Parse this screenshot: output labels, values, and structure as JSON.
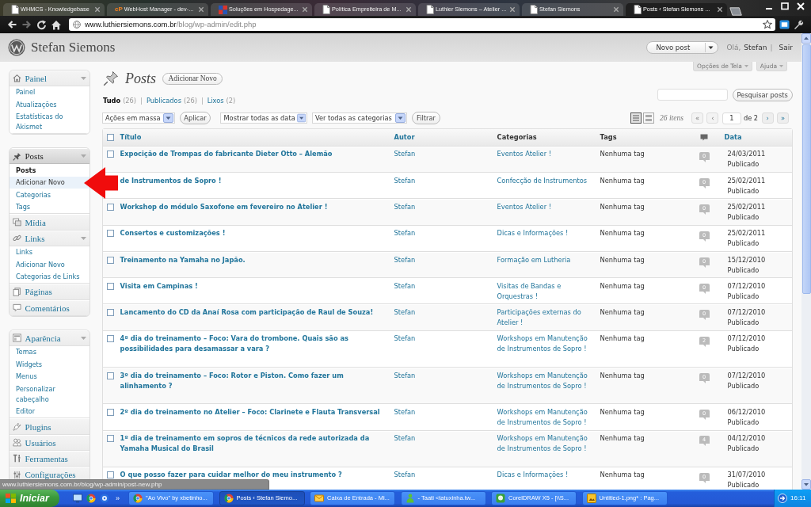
{
  "browser": {
    "tabs": [
      {
        "kind": "page",
        "title": "WHMCS - Knowledgebase",
        "selected": false
      },
      {
        "kind": "letters",
        "favicon": "cP",
        "title": "WebHost Manager - dev-...",
        "selected": false
      },
      {
        "kind": "tiles",
        "title": "Soluções em Hospedage...",
        "selected": false
      },
      {
        "kind": "page",
        "title": "Política Empreiteira de M...",
        "selected": false
      },
      {
        "kind": "page",
        "title": "Luthier Siemons – Atelier ...",
        "selected": false
      },
      {
        "kind": "page",
        "title": "Stefan Siemons",
        "selected": false
      },
      {
        "kind": "page",
        "title": "Posts ‹ Stefan Siemons ...",
        "selected": true
      }
    ],
    "address": {
      "host": "www.luthiersiemons.com.br",
      "path": "/blog/wp-admin/edit.php"
    },
    "status_url": "www.luthiersiemons.com.br/blog/wp-admin/post-new.php"
  },
  "header": {
    "site_title": "Stefan Siemons",
    "new_button": "Novo post",
    "greeting": "Olá,",
    "user": "Stefan",
    "separator": "|",
    "logout": "Sair"
  },
  "screen_meta": [
    {
      "label": "Opções de Tela"
    },
    {
      "label": "Ajuda"
    }
  ],
  "sidebar": {
    "sections": [
      {
        "items": [
          {
            "kind": "dashboard",
            "label": "Painel",
            "selected": false,
            "expanded": true,
            "children": [
              {
                "label": "Painel",
                "selected": false,
                "hovered": false
              },
              {
                "label": "Atualizações",
                "selected": false,
                "hovered": false
              },
              {
                "label": "Estatísticas do Akismet",
                "selected": false,
                "hovered": false
              }
            ]
          }
        ]
      },
      {
        "items": [
          {
            "kind": "posts",
            "label": "Posts",
            "selected": true,
            "expanded": true,
            "children": [
              {
                "label": "Posts",
                "selected": true,
                "hovered": false
              },
              {
                "label": "Adicionar Novo",
                "selected": false,
                "hovered": true
              },
              {
                "label": "Categorias",
                "selected": false,
                "hovered": false
              },
              {
                "label": "Tags",
                "selected": false,
                "hovered": false
              }
            ]
          },
          {
            "kind": "media",
            "label": "Mídia",
            "selected": false,
            "expanded": false
          },
          {
            "kind": "links",
            "label": "Links",
            "selected": false,
            "expanded": true,
            "children": [
              {
                "label": "Links",
                "selected": false,
                "hovered": false
              },
              {
                "label": "Adicionar Novo",
                "selected": false,
                "hovered": false
              },
              {
                "label": "Categorias de Links",
                "selected": false,
                "hovered": false
              }
            ]
          },
          {
            "kind": "pages",
            "label": "Páginas",
            "selected": false,
            "expanded": false
          },
          {
            "kind": "comments",
            "label": "Comentários",
            "selected": false,
            "expanded": false
          }
        ]
      },
      {
        "items": [
          {
            "kind": "appearance",
            "label": "Aparência",
            "selected": false,
            "expanded": true,
            "children": [
              {
                "label": "Temas",
                "selected": false,
                "hovered": false
              },
              {
                "label": "Widgets",
                "selected": false,
                "hovered": false
              },
              {
                "label": "Menus",
                "selected": false,
                "hovered": false
              },
              {
                "label": "Personalizar cabeçalho",
                "selected": false,
                "hovered": false
              },
              {
                "label": "Editor",
                "selected": false,
                "hovered": false
              }
            ]
          },
          {
            "kind": "plugins",
            "label": "Plugins",
            "selected": false,
            "expanded": false
          },
          {
            "kind": "users",
            "label": "Usuários",
            "selected": false,
            "expanded": false
          },
          {
            "kind": "tools",
            "label": "Ferramentas",
            "selected": false,
            "expanded": false
          },
          {
            "kind": "settings",
            "label": "Configurações",
            "selected": false,
            "expanded": false
          }
        ]
      }
    ]
  },
  "page": {
    "title": "Posts",
    "add_new": "Adicionar Novo",
    "views": [
      {
        "label": "Tudo",
        "count": "(26)",
        "selected": true
      },
      {
        "label": "Publicados",
        "count": "(26)",
        "selected": false
      },
      {
        "label": "Lixos",
        "count": "(2)",
        "selected": false
      }
    ],
    "view_separators": [
      "|",
      "|"
    ],
    "search_button": "Pesquisar posts",
    "bulk_select": "Ações em massa",
    "apply_button": "Aplicar",
    "date_select": "Mostrar todas as data",
    "category_select": "Ver todas as categorias",
    "filter_button": "Filtrar",
    "view_modes": [
      {
        "kind": "list",
        "selected": true
      },
      {
        "kind": "excerpt",
        "selected": false
      }
    ],
    "item_count": "26 itens",
    "pager_back": [
      {
        "label": "«",
        "disabled": true
      },
      {
        "label": "‹",
        "disabled": true
      }
    ],
    "current_page": "1",
    "page_total": "de 2",
    "pager_forward": [
      {
        "label": "›",
        "disabled": false
      },
      {
        "label": "»",
        "disabled": false
      }
    ]
  },
  "table": {
    "select_all": {
      "checked": false
    },
    "columns": [
      {
        "kind": "text",
        "label": "Título",
        "sortable": true
      },
      {
        "kind": "text",
        "label": "Autor",
        "sortable": true
      },
      {
        "kind": "text",
        "label": "Categorias",
        "sortable": false
      },
      {
        "kind": "text",
        "label": "Tags",
        "sortable": false
      },
      {
        "kind": "icon"
      },
      {
        "kind": "text",
        "label": "Data",
        "sortable": true
      }
    ],
    "rows": [
      {
        "checked": false,
        "title": "Expocição de Trompas do fabricante Dieter Otto – Alemão",
        "author": "Stefan",
        "categories": "Eventos Atelier !",
        "tags": "Nenhuma tag",
        "comments": "0",
        "date": "24/03/2011",
        "status": "Publicado"
      },
      {
        "title": "de Instrumentos de Sopro !",
        "author": "Stefan",
        "categories": "Confecção de Instrumentos",
        "tags": "Nenhuma tag",
        "comments": "0",
        "date": "25/02/2011",
        "status": "Publicado"
      },
      {
        "checked": false,
        "title": "Workshop do módulo Saxofone em fevereiro no Atelier !",
        "author": "Stefan",
        "categories": "Eventos Atelier !",
        "tags": "Nenhuma tag",
        "comments": "0",
        "date": "25/02/2011",
        "status": "Publicado"
      },
      {
        "checked": false,
        "title": "Consertos e customizações !",
        "author": "Stefan",
        "categories": "Dicas e Informações !",
        "tags": "Nenhuma tag",
        "comments": "0",
        "date": "25/02/2011",
        "status": "Publicado"
      },
      {
        "checked": false,
        "title": "Treinamento na Yamaha no Japão.",
        "author": "Stefan",
        "categories": "Formação em Lutheria",
        "tags": "Nenhuma tag",
        "comments": "0",
        "date": "15/12/2010",
        "status": "Publicado"
      },
      {
        "checked": false,
        "title": "Visita em Campinas !",
        "author": "Stefan",
        "categories": "Visitas de Bandas e Orquestras !",
        "tags": "Nenhuma tag",
        "comments": "0",
        "date": "07/12/2010",
        "status": "Publicado"
      },
      {
        "checked": false,
        "title": "Lancamento do CD da Anaí Rosa com participação de Raul de Souza!",
        "author": "Stefan",
        "categories": "Participações externas do Atelier !",
        "tags": "Nenhuma tag",
        "comments": "0",
        "date": "07/12/2010",
        "status": "Publicado"
      },
      {
        "checked": false,
        "title": "4º dia do treinamento – Foco: Vara do trombone. Quais são as possibilidades para desamassar a vara ?",
        "author": "Stefan",
        "categories": "Workshops em Manutenção de Instrumentos de Sopro !",
        "tags": "Nenhuma tag",
        "comments": "2",
        "date": "07/12/2010",
        "status": "Publicado"
      },
      {
        "checked": false,
        "title": "3º dia do treinamento – Foco: Rotor e Piston. Como fazer um alinhamento ?",
        "author": "Stefan",
        "categories": "Workshops em Manutenção de Instrumentos de Sopro !",
        "tags": "Nenhuma tag",
        "comments": "0",
        "date": "07/12/2010",
        "status": "Publicado"
      },
      {
        "checked": false,
        "title": "2º dia do treinamento no Atelier – Foco: Clarinete e Flauta Transversal",
        "author": "Stefan",
        "categories": "Workshops em Manutenção de Instrumentos de Sopro !",
        "tags": "Nenhuma tag",
        "comments": "0",
        "date": "06/12/2010",
        "status": "Publicado"
      },
      {
        "checked": false,
        "title": "1º dia de treinamento em sopros de técnicos da rede autorizada da Yamaha Musical do Brasil",
        "author": "Stefan",
        "categories": "Workshops em Manutenção de Instrumentos de Sopro !",
        "tags": "Nenhuma tag",
        "comments": "4",
        "date": "04/12/2010",
        "status": "Publicado"
      },
      {
        "checked": false,
        "title": "O que posso fazer para cuidar melhor do meu instrumento ?",
        "author": "Stefan",
        "categories": "Dicas e Informações !",
        "tags": "Nenhuma tag",
        "comments": "0",
        "date": "31/07/2010",
        "status": "Publicado"
      }
    ]
  },
  "taskbar": {
    "start": "Iniciar",
    "quick_launch": [
      {
        "kind": "desktop"
      },
      {
        "kind": "browser"
      },
      {
        "kind": "player"
      }
    ],
    "more": "»",
    "tasks": [
      {
        "kind": "browser",
        "label": "\"Ao Vivo\" by xbetinho...",
        "selected": false
      },
      {
        "kind": "browser",
        "label": "Posts ‹ Stefan Siemo...",
        "selected": true
      },
      {
        "kind": "mail",
        "label": "Caixa de Entrada - Mi...",
        "selected": false
      },
      {
        "kind": "messenger",
        "label": "- Taati <tatuxinha.tw...",
        "selected": false
      },
      {
        "kind": "vector",
        "label": "CorelDRAW X5 - [\\\\S...",
        "selected": false
      },
      {
        "kind": "image",
        "label": "Untitled-1.png* : Pag...",
        "selected": false
      }
    ],
    "clock": "16:11"
  }
}
